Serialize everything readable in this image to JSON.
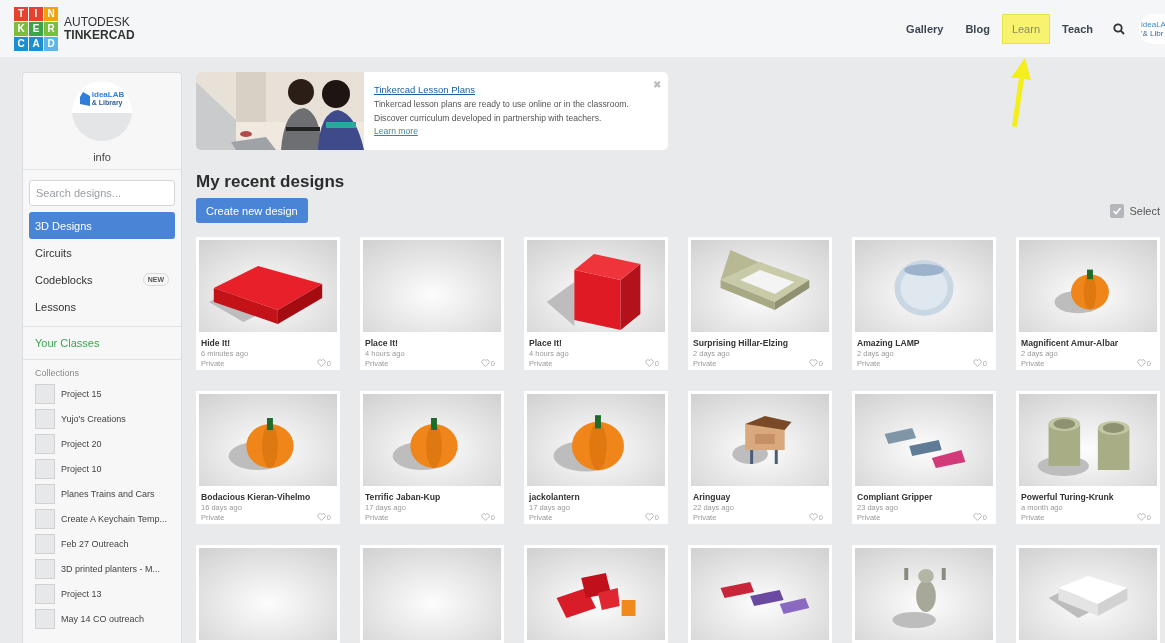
{
  "header": {
    "logo": {
      "tiles": [
        {
          "letter": "T",
          "color": "#e5412d"
        },
        {
          "letter": "I",
          "color": "#e5412d"
        },
        {
          "letter": "N",
          "color": "#f2a20f"
        },
        {
          "letter": "K",
          "color": "#7cbc3f"
        },
        {
          "letter": "E",
          "color": "#3ea34a"
        },
        {
          "letter": "R",
          "color": "#7cbc3f"
        },
        {
          "letter": "C",
          "color": "#1d8fd1"
        },
        {
          "letter": "A",
          "color": "#1d8fd1"
        },
        {
          "letter": "D",
          "color": "#5db6e6"
        }
      ],
      "brand": "AUTODESK",
      "product": "TINKERCAD"
    },
    "nav": [
      {
        "label": "Gallery",
        "highlighted": false
      },
      {
        "label": "Blog",
        "highlighted": false
      },
      {
        "label": "Learn",
        "highlighted": true
      },
      {
        "label": "Teach",
        "highlighted": false
      }
    ],
    "avatar": {
      "line_1": "ideaLA",
      "line_2": "'& Libr"
    }
  },
  "sidebar": {
    "profile": {
      "logo_line_1": "ideaLAB",
      "logo_line_2": "& Library",
      "name": "info"
    },
    "search": {
      "placeholder": "Search designs..."
    },
    "items": [
      {
        "label": "3D Designs",
        "selected": true
      },
      {
        "label": "Circuits",
        "selected": false
      },
      {
        "label": "Codeblocks",
        "selected": false,
        "badge": "NEW"
      },
      {
        "label": "Lessons",
        "selected": false
      }
    ],
    "classes_link": "Your Classes",
    "collections_heading": "Collections",
    "collections": [
      "Project 15",
      "Yujo's Creations",
      "Project 20",
      "Project 10",
      "Planes Trains and Cars",
      "Create A Keychain Temp...",
      "Feb 27 Outreach",
      "3D printed planters - M...",
      "Project 13",
      "May 14 CO outreach"
    ]
  },
  "banner": {
    "title": "Tinkercad Lesson Plans",
    "text": "Tinkercad lesson plans are ready to use online or in the classroom. Discover curriculum developed in partnership with teachers.",
    "link": "Learn more",
    "close": "✖"
  },
  "main": {
    "heading": "My recent designs",
    "create_button": "Create new design",
    "select": {
      "label": "Select",
      "checked": true
    },
    "designs": [
      {
        "title": "Hide It!",
        "time": "6 minutes ago",
        "visibility": "Private",
        "likes": "0"
      },
      {
        "title": "Place It!",
        "time": "4 hours ago",
        "visibility": "Private",
        "likes": "0"
      },
      {
        "title": "Place It!",
        "time": "4 hours ago",
        "visibility": "Private",
        "likes": "0"
      },
      {
        "title": "Surprising Hillar-Elzing",
        "time": "2 days ago",
        "visibility": "Private",
        "likes": "0"
      },
      {
        "title": "Amazing LAMP",
        "time": "2 days ago",
        "visibility": "Private",
        "likes": "0"
      },
      {
        "title": "Magnificent Amur-Albar",
        "time": "2 days ago",
        "visibility": "Private",
        "likes": "0"
      },
      {
        "title": "Bodacious Kieran-Vihelmo",
        "time": "16 days ago",
        "visibility": "Private",
        "likes": "0"
      },
      {
        "title": "Terrific Jaban-Kup",
        "time": "17 days ago",
        "visibility": "Private",
        "likes": "0"
      },
      {
        "title": "jackolantern",
        "time": "17 days ago",
        "visibility": "Private",
        "likes": "0"
      },
      {
        "title": "Aringuay",
        "time": "22 days ago",
        "visibility": "Private",
        "likes": "0"
      },
      {
        "title": "Compliant Gripper",
        "time": "23 days ago",
        "visibility": "Private",
        "likes": "0"
      },
      {
        "title": "Powerful Turing-Krunk",
        "time": "a month ago",
        "visibility": "Private",
        "likes": "0"
      },
      {
        "kind": "picture"
      },
      {
        "kind": "picture"
      },
      {
        "kind": "picture"
      },
      {
        "kind": "picture"
      },
      {
        "kind": "picture"
      },
      {
        "kind": "picture"
      }
    ]
  }
}
